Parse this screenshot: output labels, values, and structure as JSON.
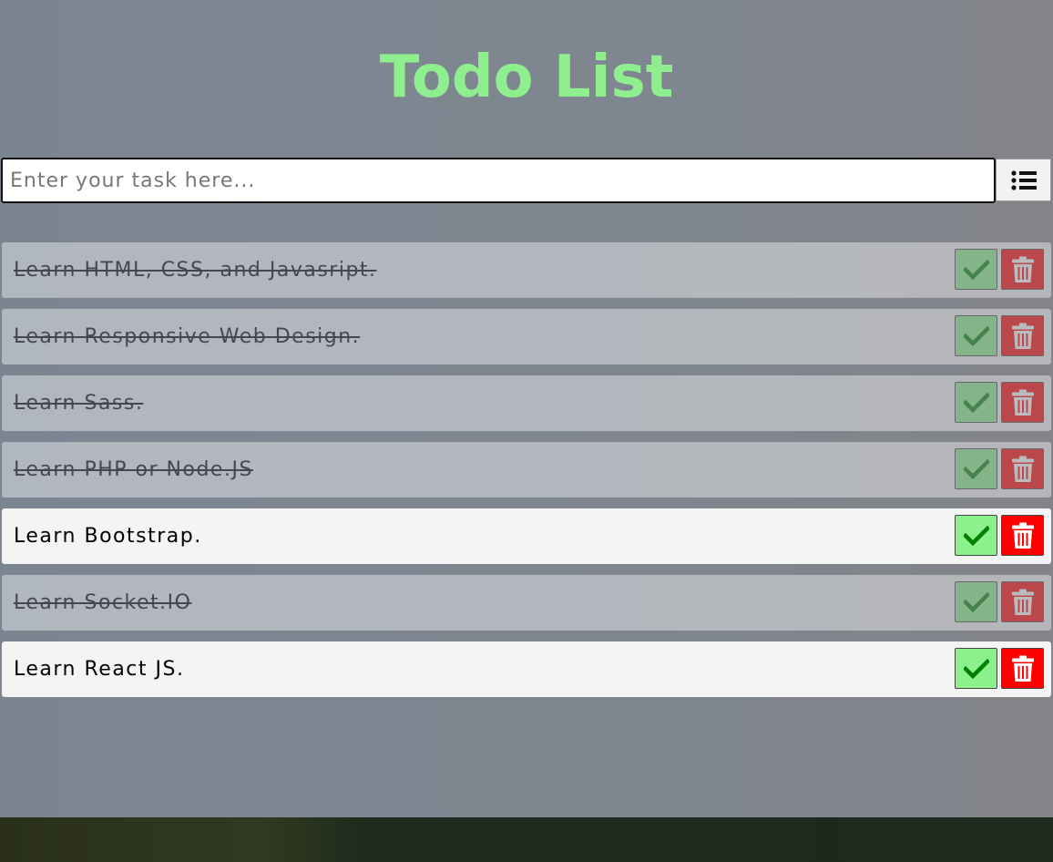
{
  "header": {
    "title": "Todo List"
  },
  "form": {
    "input_placeholder": "Enter your task here...",
    "input_value": "",
    "add_button_icon": "list-icon"
  },
  "todos": [
    {
      "text": "Learn HTML, CSS, and Javasript.",
      "completed": true
    },
    {
      "text": "Learn Responsive Web Design.",
      "completed": true
    },
    {
      "text": "Learn Sass.",
      "completed": true
    },
    {
      "text": "Learn PHP or Node.JS",
      "completed": true
    },
    {
      "text": "Learn Bootstrap.",
      "completed": false
    },
    {
      "text": "Learn Socket.IO",
      "completed": true
    },
    {
      "text": "Learn React JS.",
      "completed": false
    }
  ],
  "item_actions": {
    "complete_icon": "checkmark-icon",
    "delete_icon": "trash-icon"
  },
  "colors": {
    "title": "#8fef8f",
    "complete_button": "#8cf08c",
    "checkmark": "#008000",
    "delete_button": "#fe0000",
    "item_background": "#f4f4f4",
    "page_background": "#7e8691"
  }
}
